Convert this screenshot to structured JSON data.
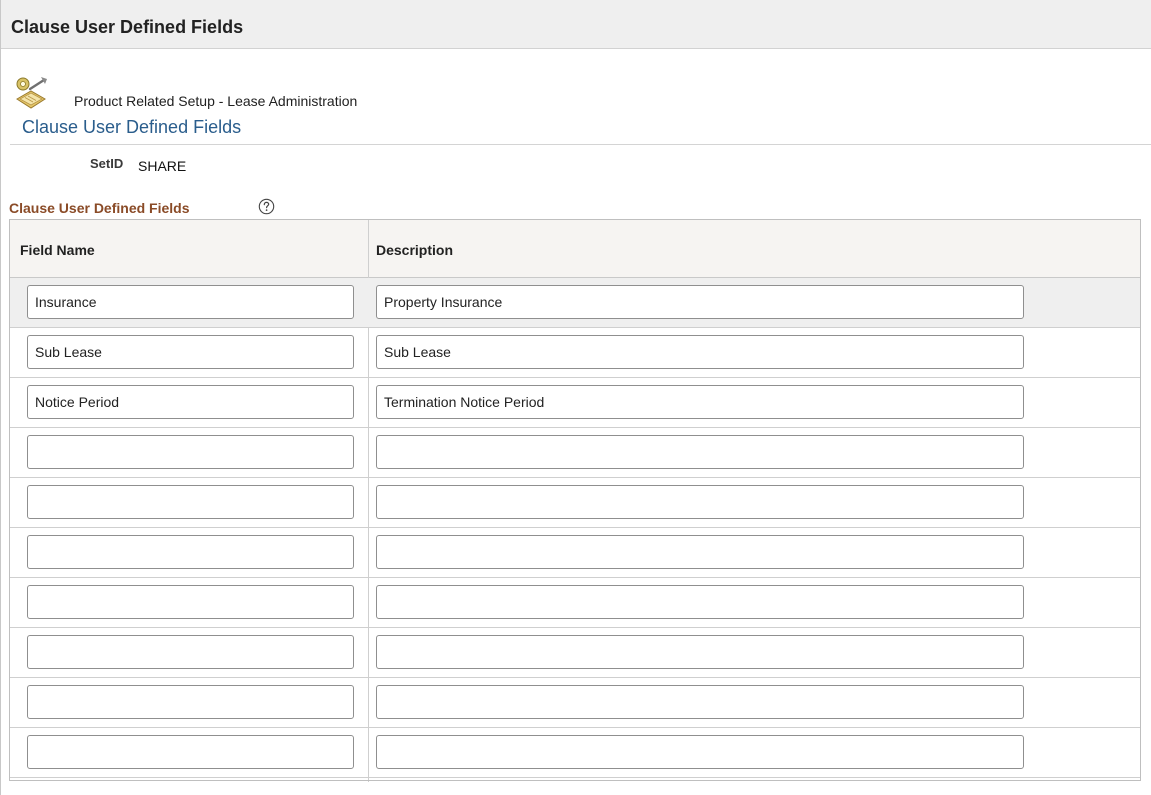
{
  "banner": {
    "title": "Clause User Defined Fields"
  },
  "header": {
    "icon": "setup-tools-icon",
    "breadcrumb": "Product Related Setup - Lease Administration",
    "page_title": "Clause User Defined Fields"
  },
  "setid": {
    "label": "SetID",
    "value": "SHARE"
  },
  "grid": {
    "title": "Clause User Defined Fields",
    "help_icon": "help-question-icon",
    "columns": [
      "Field Name",
      "Description"
    ],
    "rows": [
      {
        "field_name": "Insurance",
        "description": "Property Insurance"
      },
      {
        "field_name": "Sub Lease",
        "description": "Sub Lease"
      },
      {
        "field_name": "Notice Period",
        "description": "Termination Notice Period"
      },
      {
        "field_name": "",
        "description": ""
      },
      {
        "field_name": "",
        "description": ""
      },
      {
        "field_name": "",
        "description": ""
      },
      {
        "field_name": "",
        "description": ""
      },
      {
        "field_name": "",
        "description": ""
      },
      {
        "field_name": "",
        "description": ""
      },
      {
        "field_name": "",
        "description": ""
      }
    ]
  },
  "colors": {
    "page_title": "#2a5d8c",
    "grid_title": "#8a4b27",
    "banner_background": "#efefef",
    "active_row": "#efefef"
  }
}
